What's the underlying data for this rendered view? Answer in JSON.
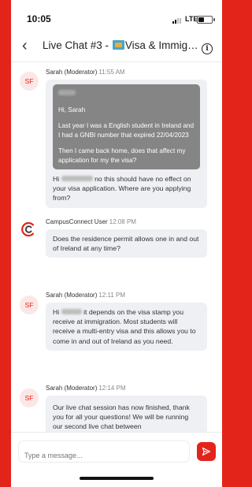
{
  "status_bar": {
    "time": "10:05",
    "network": "LTE"
  },
  "header": {
    "back_icon": "chevron-left-icon",
    "title_prefix": "Live Chat #3 -",
    "title_suffix": "Visa & Immigratio...",
    "info_icon": "info-icon"
  },
  "messages": [
    {
      "avatar": "SF",
      "sender": "Sarah (Moderator)",
      "time": "11:55 AM",
      "quote": {
        "greeting": "Hi, Sarah",
        "line1": "Last year I was a English student in Ireland and I had a GNBI number that expired 22/04/2023",
        "line2": "Then I came back home, does that affect my application for my the visa?"
      },
      "reply_prefix": "Hi",
      "reply_text": "no this should have no effect on your visa application. Where are you applying from?"
    },
    {
      "avatar_icon": "campusconnect-logo-icon",
      "sender": "CampusConnect User",
      "time": "12:08 PM",
      "text": "Does the residence permit allows one in and out of Ireland at any time?"
    },
    {
      "avatar": "SF",
      "sender": "Sarah (Moderator)",
      "time": "12:11 PM",
      "text_prefix": "Hi",
      "text": "it depends on the visa stamp you receive at immigration. Most students will receive a multi-entry visa and this allows you to come in and out of Ireland as you need."
    },
    {
      "avatar": "SF",
      "sender": "Sarah (Moderator)",
      "time": "12:14 PM",
      "text": "Our live chat session has now finished, thank you for all your questions! We will be running our second live chat between"
    }
  ],
  "composer": {
    "placeholder": "Type a message...",
    "send_icon": "send-icon"
  },
  "colors": {
    "accent": "#e3241b",
    "bubble": "#eef0f4",
    "quote": "#858585"
  }
}
